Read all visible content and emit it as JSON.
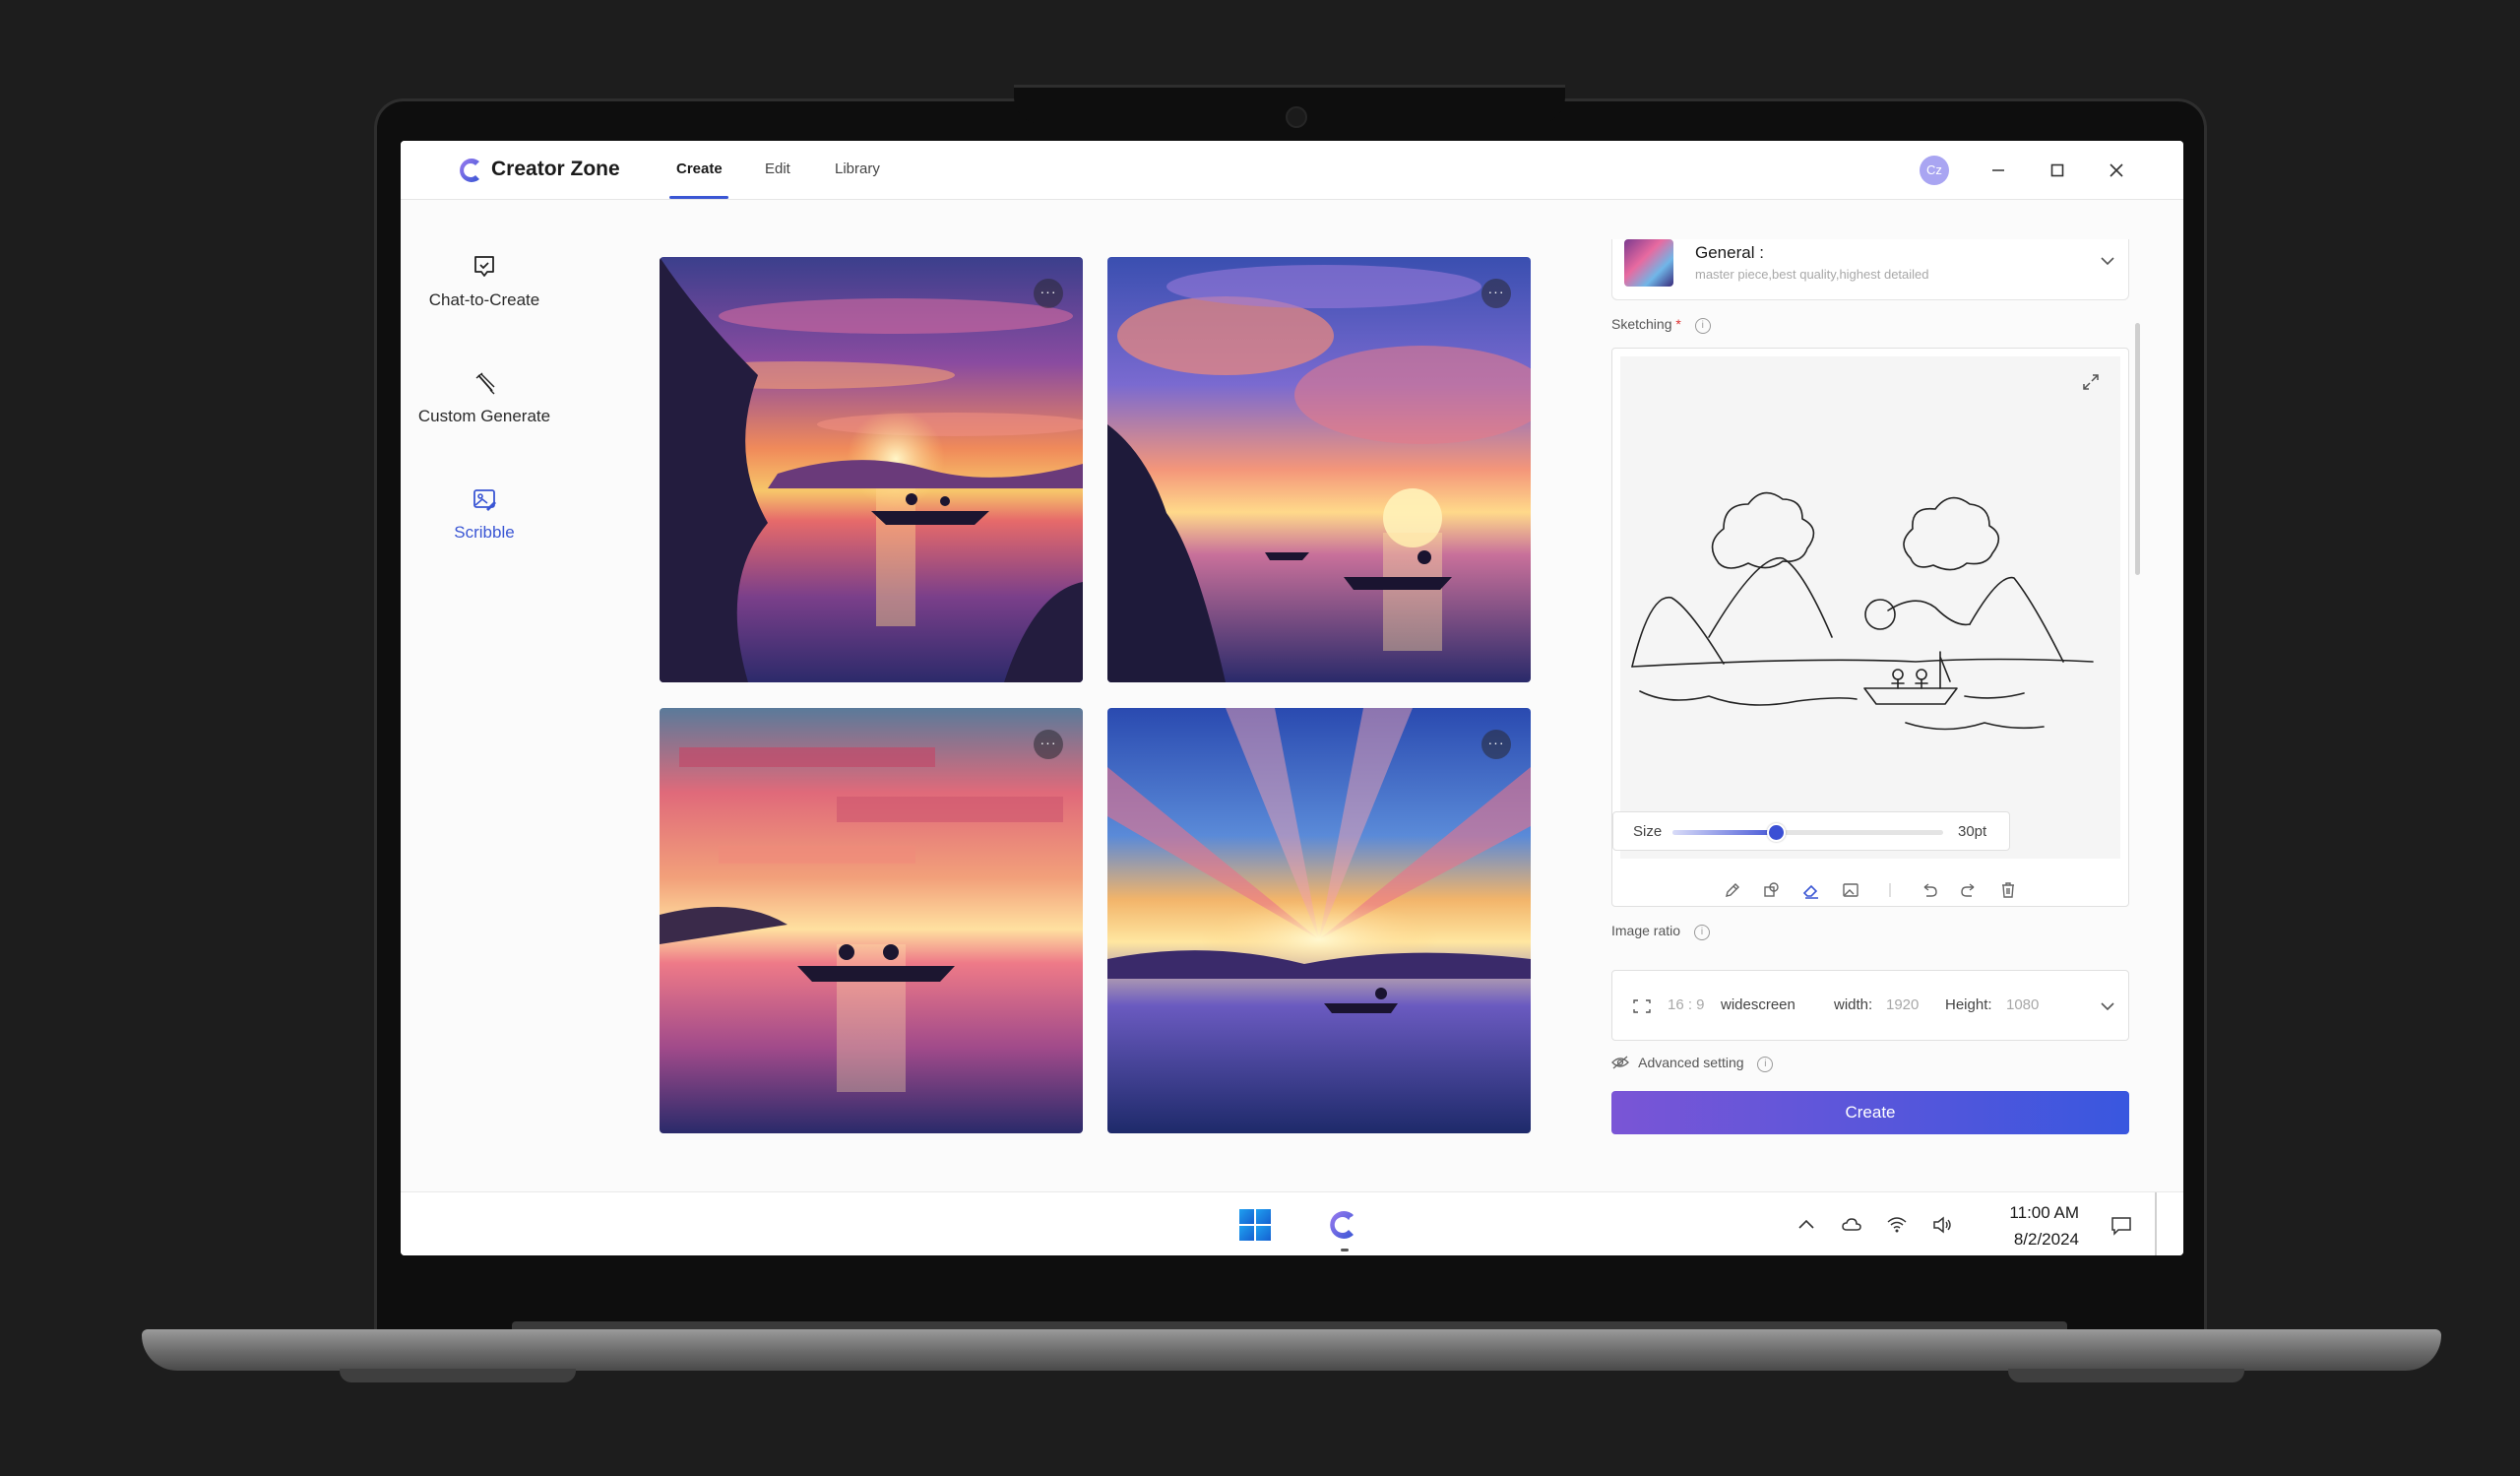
{
  "app": {
    "title": "Creator Zone",
    "avatar_initials": "Cz",
    "tabs": [
      {
        "label": "Create",
        "active": true
      },
      {
        "label": "Edit",
        "active": false
      },
      {
        "label": "Library",
        "active": false
      }
    ]
  },
  "sidebar": {
    "items": [
      {
        "label": "Chat-to-Create",
        "icon": "chat-create-icon",
        "active": false
      },
      {
        "label": "Custom Generate",
        "icon": "magic-wand-icon",
        "active": false
      },
      {
        "label": "Scribble",
        "icon": "scribble-image-icon",
        "active": true
      }
    ]
  },
  "gallery": {
    "images": [
      {
        "description": "sunset lake with two fishermen in boat",
        "more": "···"
      },
      {
        "description": "sunset clouds over lake with boat",
        "more": "···"
      },
      {
        "description": "pixel sunset with two people in boat",
        "more": "···"
      },
      {
        "description": "radiant sky reflection with fisherman",
        "more": "···"
      }
    ]
  },
  "panel": {
    "style": {
      "name": "General :",
      "description": "master piece,best quality,highest detailed"
    },
    "sketching_label": "Sketching",
    "sketching_required": "*",
    "size": {
      "label": "Size",
      "value_label": "30pt",
      "fraction": 0.38
    },
    "image_ratio": {
      "label": "Image ratio",
      "ratio": "16 : 9",
      "preset": "widescreen",
      "width_label": "width:",
      "width_value": "1920",
      "height_label": "Height:",
      "height_value": "1080"
    },
    "advanced_label": "Advanced setting",
    "create_label": "Create"
  },
  "taskbar": {
    "time": "11:00 AM",
    "date": "8/2/2024"
  },
  "colors": {
    "accent": "#3a56d4",
    "button_gradient_start": "#7a55d6",
    "button_gradient_end": "#3957df"
  }
}
